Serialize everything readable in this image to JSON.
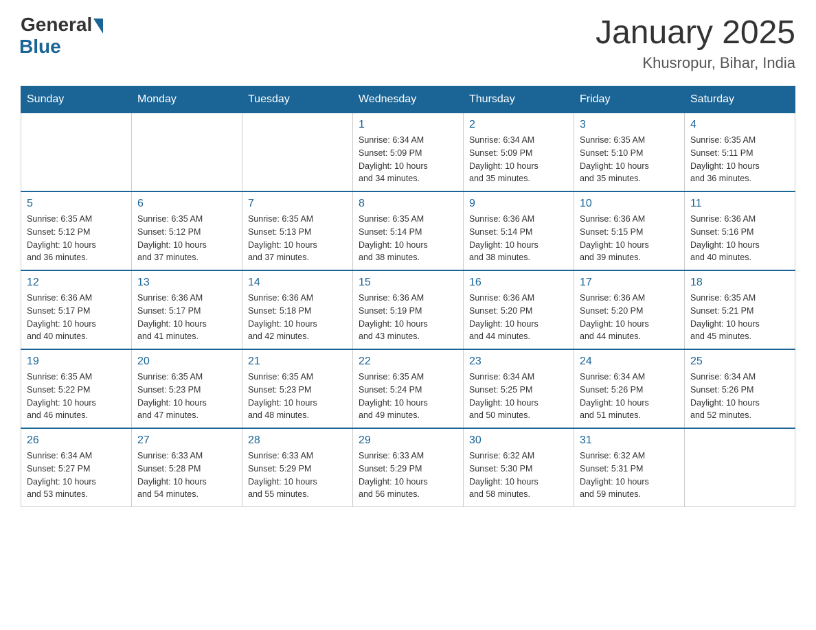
{
  "header": {
    "logo_general": "General",
    "logo_blue": "Blue",
    "title": "January 2025",
    "subtitle": "Khusropur, Bihar, India"
  },
  "days_of_week": [
    "Sunday",
    "Monday",
    "Tuesday",
    "Wednesday",
    "Thursday",
    "Friday",
    "Saturday"
  ],
  "weeks": [
    [
      {
        "day": "",
        "info": ""
      },
      {
        "day": "",
        "info": ""
      },
      {
        "day": "",
        "info": ""
      },
      {
        "day": "1",
        "info": "Sunrise: 6:34 AM\nSunset: 5:09 PM\nDaylight: 10 hours\nand 34 minutes."
      },
      {
        "day": "2",
        "info": "Sunrise: 6:34 AM\nSunset: 5:09 PM\nDaylight: 10 hours\nand 35 minutes."
      },
      {
        "day": "3",
        "info": "Sunrise: 6:35 AM\nSunset: 5:10 PM\nDaylight: 10 hours\nand 35 minutes."
      },
      {
        "day": "4",
        "info": "Sunrise: 6:35 AM\nSunset: 5:11 PM\nDaylight: 10 hours\nand 36 minutes."
      }
    ],
    [
      {
        "day": "5",
        "info": "Sunrise: 6:35 AM\nSunset: 5:12 PM\nDaylight: 10 hours\nand 36 minutes."
      },
      {
        "day": "6",
        "info": "Sunrise: 6:35 AM\nSunset: 5:12 PM\nDaylight: 10 hours\nand 37 minutes."
      },
      {
        "day": "7",
        "info": "Sunrise: 6:35 AM\nSunset: 5:13 PM\nDaylight: 10 hours\nand 37 minutes."
      },
      {
        "day": "8",
        "info": "Sunrise: 6:35 AM\nSunset: 5:14 PM\nDaylight: 10 hours\nand 38 minutes."
      },
      {
        "day": "9",
        "info": "Sunrise: 6:36 AM\nSunset: 5:14 PM\nDaylight: 10 hours\nand 38 minutes."
      },
      {
        "day": "10",
        "info": "Sunrise: 6:36 AM\nSunset: 5:15 PM\nDaylight: 10 hours\nand 39 minutes."
      },
      {
        "day": "11",
        "info": "Sunrise: 6:36 AM\nSunset: 5:16 PM\nDaylight: 10 hours\nand 40 minutes."
      }
    ],
    [
      {
        "day": "12",
        "info": "Sunrise: 6:36 AM\nSunset: 5:17 PM\nDaylight: 10 hours\nand 40 minutes."
      },
      {
        "day": "13",
        "info": "Sunrise: 6:36 AM\nSunset: 5:17 PM\nDaylight: 10 hours\nand 41 minutes."
      },
      {
        "day": "14",
        "info": "Sunrise: 6:36 AM\nSunset: 5:18 PM\nDaylight: 10 hours\nand 42 minutes."
      },
      {
        "day": "15",
        "info": "Sunrise: 6:36 AM\nSunset: 5:19 PM\nDaylight: 10 hours\nand 43 minutes."
      },
      {
        "day": "16",
        "info": "Sunrise: 6:36 AM\nSunset: 5:20 PM\nDaylight: 10 hours\nand 44 minutes."
      },
      {
        "day": "17",
        "info": "Sunrise: 6:36 AM\nSunset: 5:20 PM\nDaylight: 10 hours\nand 44 minutes."
      },
      {
        "day": "18",
        "info": "Sunrise: 6:35 AM\nSunset: 5:21 PM\nDaylight: 10 hours\nand 45 minutes."
      }
    ],
    [
      {
        "day": "19",
        "info": "Sunrise: 6:35 AM\nSunset: 5:22 PM\nDaylight: 10 hours\nand 46 minutes."
      },
      {
        "day": "20",
        "info": "Sunrise: 6:35 AM\nSunset: 5:23 PM\nDaylight: 10 hours\nand 47 minutes."
      },
      {
        "day": "21",
        "info": "Sunrise: 6:35 AM\nSunset: 5:23 PM\nDaylight: 10 hours\nand 48 minutes."
      },
      {
        "day": "22",
        "info": "Sunrise: 6:35 AM\nSunset: 5:24 PM\nDaylight: 10 hours\nand 49 minutes."
      },
      {
        "day": "23",
        "info": "Sunrise: 6:34 AM\nSunset: 5:25 PM\nDaylight: 10 hours\nand 50 minutes."
      },
      {
        "day": "24",
        "info": "Sunrise: 6:34 AM\nSunset: 5:26 PM\nDaylight: 10 hours\nand 51 minutes."
      },
      {
        "day": "25",
        "info": "Sunrise: 6:34 AM\nSunset: 5:26 PM\nDaylight: 10 hours\nand 52 minutes."
      }
    ],
    [
      {
        "day": "26",
        "info": "Sunrise: 6:34 AM\nSunset: 5:27 PM\nDaylight: 10 hours\nand 53 minutes."
      },
      {
        "day": "27",
        "info": "Sunrise: 6:33 AM\nSunset: 5:28 PM\nDaylight: 10 hours\nand 54 minutes."
      },
      {
        "day": "28",
        "info": "Sunrise: 6:33 AM\nSunset: 5:29 PM\nDaylight: 10 hours\nand 55 minutes."
      },
      {
        "day": "29",
        "info": "Sunrise: 6:33 AM\nSunset: 5:29 PM\nDaylight: 10 hours\nand 56 minutes."
      },
      {
        "day": "30",
        "info": "Sunrise: 6:32 AM\nSunset: 5:30 PM\nDaylight: 10 hours\nand 58 minutes."
      },
      {
        "day": "31",
        "info": "Sunrise: 6:32 AM\nSunset: 5:31 PM\nDaylight: 10 hours\nand 59 minutes."
      },
      {
        "day": "",
        "info": ""
      }
    ]
  ]
}
